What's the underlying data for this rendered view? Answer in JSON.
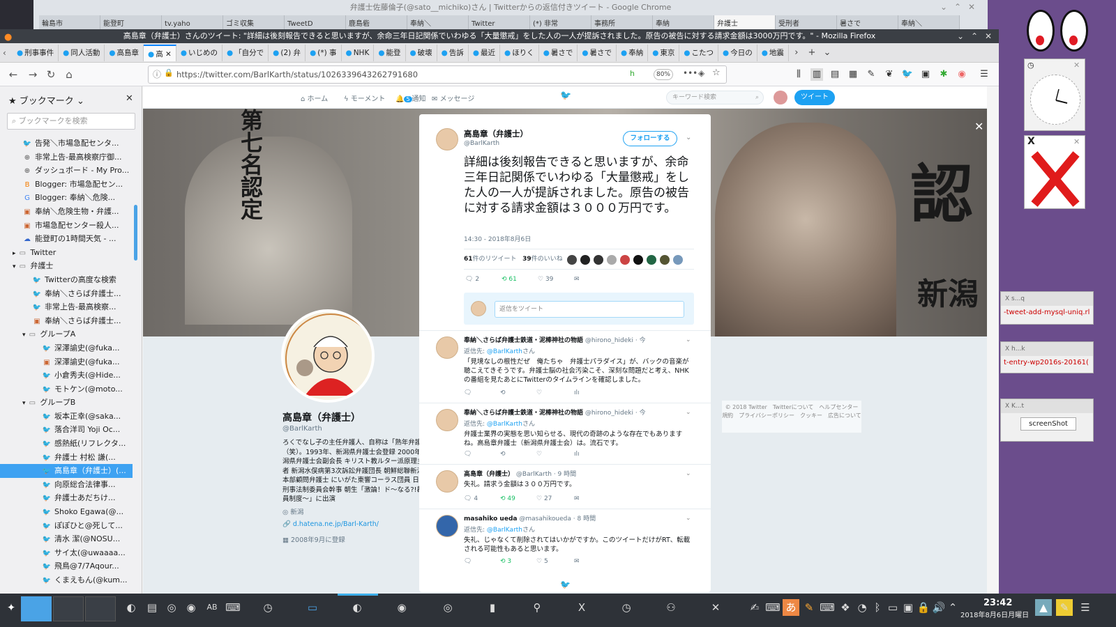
{
  "chrome": {
    "title": "弁護士佐藤倫子(@sato__michiko)さん | Twitterからの返信付きツイート - Google Chrome",
    "tabs": [
      "輪島市",
      "能登町",
      "tv.yaho",
      "ゴミ収集",
      "TweetD",
      "鹿島砦",
      "奉納＼",
      "Twitter",
      "(*) 非常",
      "事務所",
      "奉納",
      "弁護士",
      "受刑者",
      "暑さで",
      "奉納＼"
    ]
  },
  "firefox": {
    "title": "高島章（弁護士）さんのツイート: \"詳細は後刻報告できると思いますが、余命三年日記関係でいわゆる「大量懲戒」をした人の一人が提訴されました。原告の被告に対する請求金額は3000万円です。\" - Mozilla Firefox",
    "tabs": [
      "刑事事件",
      "同人活動",
      "高島章",
      "高",
      "いじめの",
      "「自分で",
      "(2) 弁",
      "(*) 事",
      "NHK",
      "能登",
      "破壊",
      "告訴",
      "最近",
      "ほりく",
      "暑さで",
      "暑さで",
      "奉納",
      "東京",
      "こたつ",
      "今日の",
      "地震"
    ],
    "url": "https://twitter.com/BarlKarth/status/1026339643262791680",
    "zoom": "80%"
  },
  "sidebar": {
    "title": "ブックマーク",
    "search_placeholder": "ブックマークを検索",
    "items": [
      {
        "label": "告発＼市場急配センタ...",
        "icon": "twitter-icon",
        "indent": 3
      },
      {
        "label": "非常上告-最高検察庁御...",
        "icon": "globe-icon",
        "indent": 3
      },
      {
        "label": "ダッシュボード - My Pro...",
        "icon": "globe-icon",
        "indent": 3
      },
      {
        "label": "Blogger: 市場急配セン...",
        "icon": "blogger-icon",
        "indent": 3
      },
      {
        "label": "Blogger: 奉納＼危険...",
        "icon": "google-icon",
        "indent": 3
      },
      {
        "label": "奉納＼危険生物・弁護...",
        "icon": "page-icon",
        "indent": 3
      },
      {
        "label": "市場急配センター殺人...",
        "icon": "page-icon",
        "indent": 3
      },
      {
        "label": "能登町の1時間天気 - ...",
        "icon": "weather-icon",
        "indent": 3
      },
      {
        "label": "Twitter",
        "icon": "folder-icon",
        "indent": 2,
        "folder": "closed"
      },
      {
        "label": "弁護士",
        "icon": "folder-icon",
        "indent": 2,
        "folder": "open"
      },
      {
        "label": "Twitterの高度な検索",
        "icon": "twitter-icon",
        "indent": 4
      },
      {
        "label": "奉納＼さらば弁護士...",
        "icon": "twitter-icon",
        "indent": 4
      },
      {
        "label": "非常上告-最高検察...",
        "icon": "twitter-icon",
        "indent": 4
      },
      {
        "label": "奉納＼さらば弁護士...",
        "icon": "page-icon",
        "indent": 4
      },
      {
        "label": "グループA",
        "icon": "folder-icon",
        "indent": 3,
        "folder": "open"
      },
      {
        "label": "深澤諭史(@fuka...",
        "icon": "twitter-icon",
        "indent": 5
      },
      {
        "label": "深澤諭史(@fuka...",
        "icon": "page-icon",
        "indent": 5
      },
      {
        "label": "小倉秀夫(@Hide...",
        "icon": "twitter-icon",
        "indent": 5
      },
      {
        "label": "モトケン(@moto...",
        "icon": "twitter-icon",
        "indent": 5
      },
      {
        "label": "グループB",
        "icon": "folder-icon",
        "indent": 3,
        "folder": "open"
      },
      {
        "label": "坂本正幸(@saka...",
        "icon": "twitter-icon",
        "indent": 5
      },
      {
        "label": "落合洋司 Yoji Oc...",
        "icon": "twitter-icon",
        "indent": 5
      },
      {
        "label": "感熱紙(リフレクタ...",
        "icon": "twitter-icon",
        "indent": 5
      },
      {
        "label": "弁護士 村松 謙(...",
        "icon": "twitter-icon",
        "indent": 5
      },
      {
        "label": "高島章（弁護士）(...",
        "icon": "twitter-icon",
        "indent": 5,
        "selected": true
      },
      {
        "label": "向原総合法律事...",
        "icon": "twitter-icon",
        "indent": 5
      },
      {
        "label": "弁護士あだちけ...",
        "icon": "twitter-icon",
        "indent": 5
      },
      {
        "label": "Shoko Egawa(@...",
        "icon": "twitter-icon",
        "indent": 5
      },
      {
        "label": "ぽぽひと@死して...",
        "icon": "twitter-icon",
        "indent": 5
      },
      {
        "label": "清水 潔(@NOSU...",
        "icon": "twitter-icon",
        "indent": 5
      },
      {
        "label": "サイ太(@uwaaaa...",
        "icon": "twitter-icon",
        "indent": 5
      },
      {
        "label": "飛鳥@7/7Aqour...",
        "icon": "twitter-icon",
        "indent": 5
      },
      {
        "label": "くまえもん(@kum...",
        "icon": "twitter-icon",
        "indent": 5
      }
    ]
  },
  "twitter": {
    "nav": [
      "ホーム",
      "モーメント",
      "通知",
      "メッセージ"
    ],
    "search_placeholder": "キーワード検索",
    "tweet_button": "ツイート",
    "notif_count": "5",
    "banner_kanji_left": "第七名認定",
    "banner_kanji_right": "認",
    "banner_kanji_right2": "新潟",
    "profile": {
      "name": "高島章（弁護士）",
      "handle": "@BarlKarth",
      "bio": "ろくでなし子の主任弁護人、自称は「熟年弁護士」（笑）。1993年、新潟県弁護士会登録 2000年、新潟県弁護士会副会長 キリスト教ルター派原理主義者 新潟水俣病第3次訴訟弁護団長 朝鮮総聯新潟県本部顧問弁護士 にいがた東響コーラス団員 日弁連刑事法制委員会幹事 朝生「激論！ド〜なる?!裁判員制度〜」に出演",
      "location": "新潟",
      "link": "d.hatena.ne.jp/Barl-Karth/",
      "joined": "2008年9月に登録"
    },
    "footer": "© 2018 Twitter　Twitterについて　ヘルプセンター　規約　プライバシーポリシー　クッキー　広告について",
    "tweet": {
      "name": "高島章（弁護士）",
      "handle": "@BarlKarth",
      "follow": "フォローする",
      "text": "詳細は後刻報告できると思いますが、余命三年日記関係でいわゆる「大量懲戒」をした人の一人が提訴されました。原告の被告に対する請求金額は３０００万円です。",
      "time": "14:30 - 2018年8月6日",
      "retweets": "61",
      "retweets_label": "件のリツイート",
      "likes": "39",
      "likes_label": "件のいいね",
      "reply_count": "2",
      "rt_count": "61",
      "like_count": "39",
      "reply_placeholder": "返信をツイート"
    },
    "replies": [
      {
        "name": "奉納＼さらば弁護士鉄道・泥棒神社の物語",
        "handle": "@hirono_hideki · 今",
        "to_label": "返信先:",
        "to": "@BarlKarth",
        "to_suffix": "さん",
        "text": "「見境なしの根性だぜ　俺たちゃ　弁護士パラダイス」が、バックの音楽が聴こえてきそうです。弁護士脳の社会汚染こそ、深刻な問題だと考え、NHKの番組を見たあとにTwitterのタイムラインを確認しました。",
        "reply": "",
        "rt": "",
        "like": ""
      },
      {
        "name": "奉納＼さらば弁護士鉄道・泥棒神社の物語",
        "handle": "@hirono_hideki · 今",
        "to_label": "返信先:",
        "to": "@BarlKarth",
        "to_suffix": "さん",
        "text": "弁護士業界の実態を思い知らせる、現代の奇跡のような存在でもありますね。高島章弁護士（新潟県弁護士会）は。流石です。",
        "reply": "",
        "rt": "",
        "like": ""
      },
      {
        "name": "高島章（弁護士）",
        "handle": "@BarlKarth · 9 時間",
        "to_label": "",
        "to": "",
        "to_suffix": "",
        "text": "失礼。請求う金額は３００万円です。",
        "reply": "4",
        "rt": "49",
        "like": "27"
      },
      {
        "name": "masahiko ueda",
        "handle": "@masahikoueda · 8 時間",
        "to_label": "返信先:",
        "to": "@BarlKarth",
        "to_suffix": "さん",
        "text": "失礼、じゃなくて削除されてはいかがですか。このツイートだけがRT、転載される可能性もあると思います。",
        "reply": "",
        "rt": "3",
        "like": "5"
      }
    ]
  },
  "desktop": {
    "widgets": [
      "s...q",
      "h...k",
      "K...t"
    ],
    "widget_texts": [
      "-tweet-add-mysql-uniq.rl",
      "t-entry-wp2016s-20161(",
      "screenShot"
    ]
  },
  "taskbar": {
    "time": "23:42",
    "date": "2018年8月6日月曜日"
  },
  "colors": {
    "twitter_blue": "#1da1f2",
    "selection": "#3ea2f2",
    "desktop": "#6b4d8c"
  }
}
